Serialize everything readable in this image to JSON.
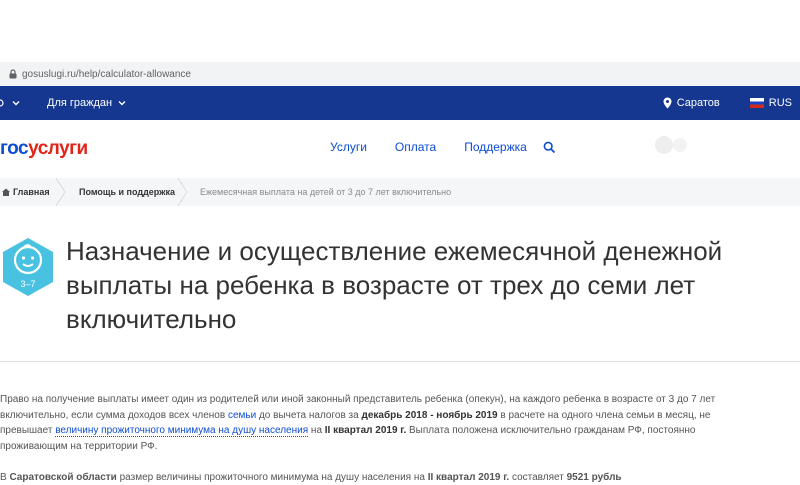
{
  "browser": {
    "url": "gosuslugi.ru/help/calculator-allowance"
  },
  "topbar": {
    "audience": "Для граждан",
    "location": "Саратов",
    "language": "RUS"
  },
  "header": {
    "logo_part1": "гос",
    "logo_part2": "услуги",
    "nav": [
      "Услуги",
      "Оплата",
      "Поддержка"
    ]
  },
  "breadcrumbs": [
    "Главная",
    "Помощь и поддержка",
    "Ежемесячная выплата на детей от 3 до 7 лет включительно"
  ],
  "page": {
    "badge": "3–7",
    "title": "Назначение и осуществление ежемесячной денежной выплаты на ребенка в возрасте от трех до семи лет включительно",
    "para1": {
      "t1": "Право на получение выплаты имеет один из родителей или иной законный представитель ребенка (опекун), на каждого ребенка в возрасте от 3 до 7 лет включительно, если сумма доходов всех членов ",
      "link1": "семьи",
      "t2": " до вычета налогов за ",
      "b1": "декабрь 2018 - ноябрь 2019",
      "t3": " в расчете на одного члена семьи в месяц, не превышает ",
      "link2": "величину прожиточного минимума на душу населения",
      "t4": " на ",
      "b2": "II квартал 2019 г.",
      "t5": " Выплата положена исключительно гражданам РФ, постоянно проживающим на территории РФ."
    },
    "para2": {
      "t1": "В ",
      "b1": "Саратовской области",
      "t2": " размер величины прожиточного минимума на душу населения на ",
      "b2": "II квартал 2019 г.",
      "t3": " составляет ",
      "b3": "9521 рубль"
    }
  },
  "colors": {
    "brand_blue": "#0d4cd3",
    "top_bar": "#15378f",
    "brand_red": "#e1251b"
  }
}
